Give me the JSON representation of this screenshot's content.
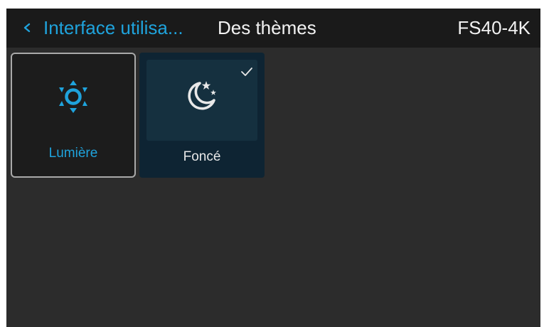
{
  "header": {
    "back_label": "Interface utilisa...",
    "title": "Des thèmes",
    "device": "FS40-4K"
  },
  "themes": [
    {
      "label": "Lumière",
      "icon": "sun-icon",
      "focused": true,
      "selected": false
    },
    {
      "label": "Foncé",
      "icon": "moon-stars-icon",
      "focused": false,
      "selected": true
    }
  ],
  "colors": {
    "accent": "#1fa3dc",
    "background": "#2c2c2c",
    "header_background": "#1a1a1a",
    "selected_tile": "#0e2433"
  }
}
